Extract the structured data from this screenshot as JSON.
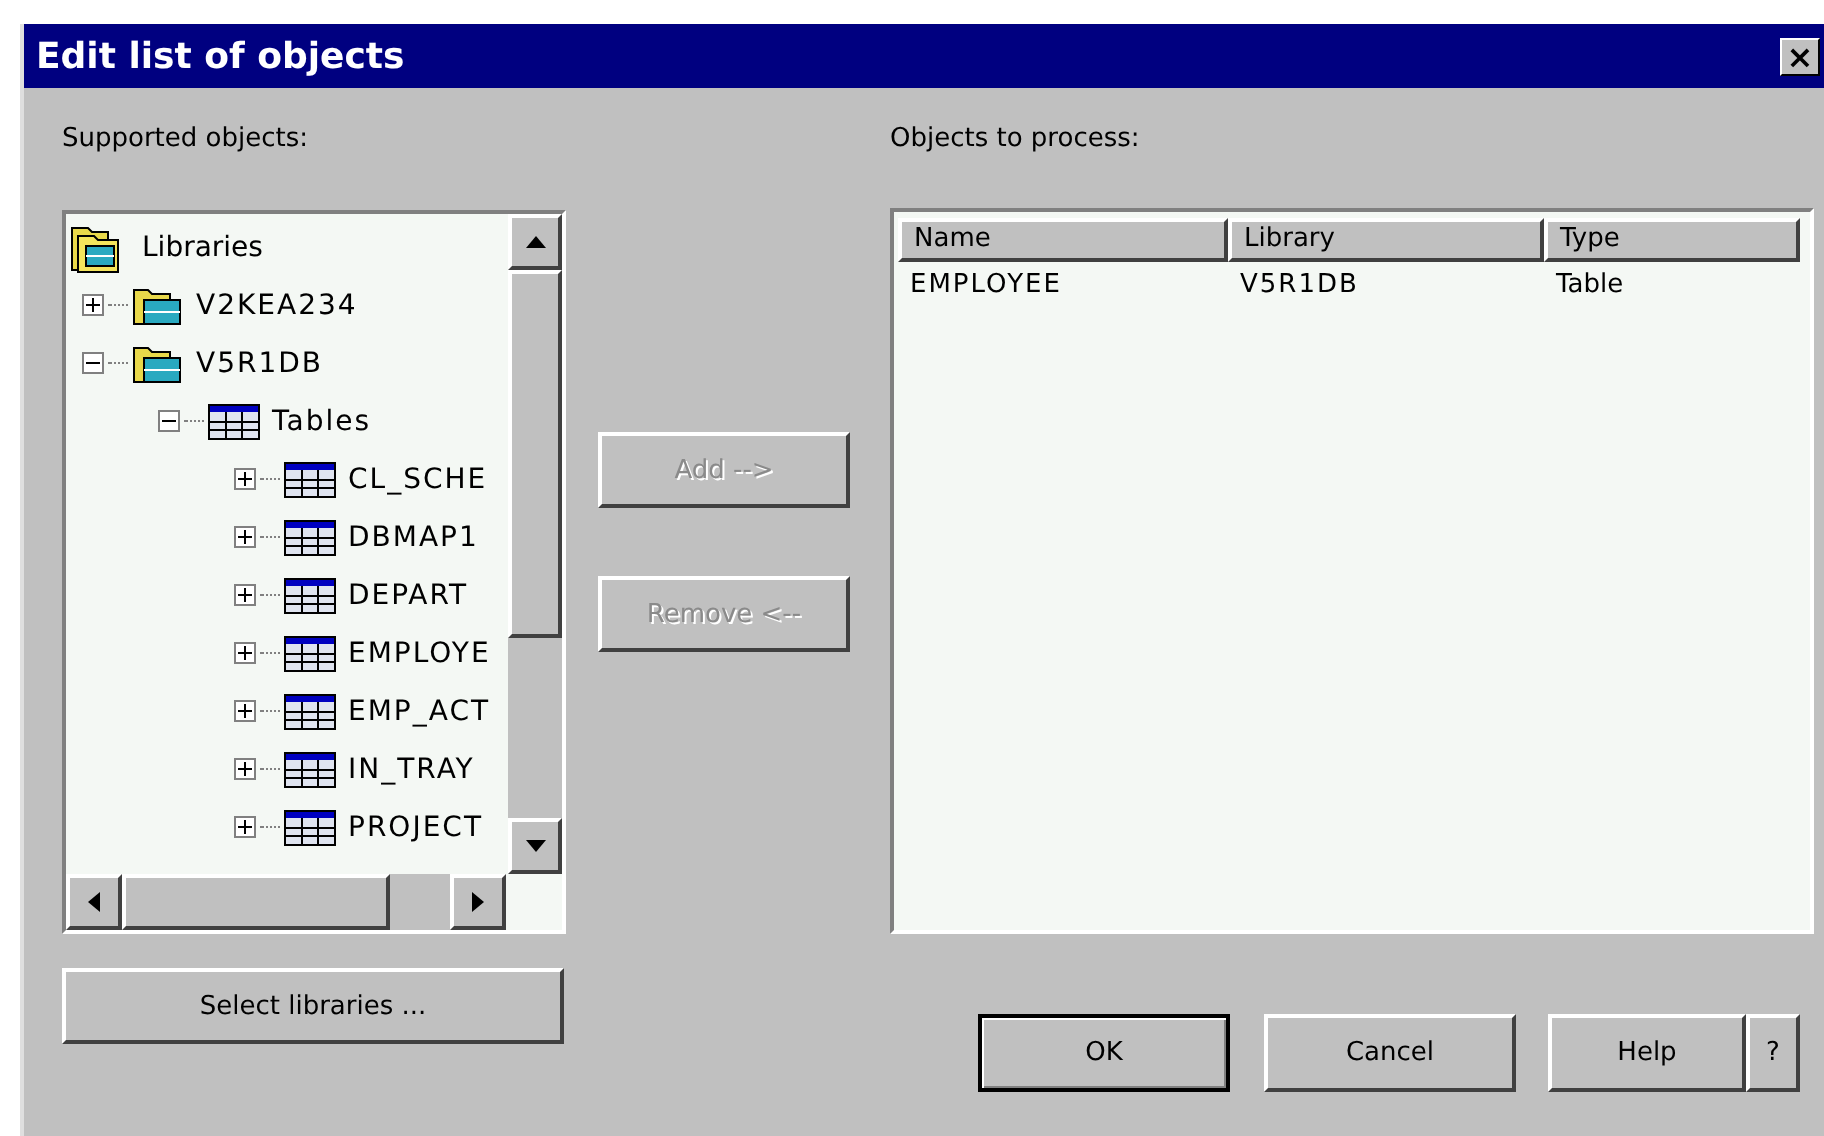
{
  "window": {
    "title": "Edit list of objects",
    "close": "×"
  },
  "supported_label": "Supported objects:",
  "process_label": "Objects to process:",
  "tree": {
    "label": "Libraries",
    "kind": "libraries",
    "children": [
      {
        "label": "V2KEA234",
        "kind": "library",
        "expanded": false
      },
      {
        "label": "V5R1DB",
        "kind": "library",
        "expanded": true,
        "children": [
          {
            "label": "Tables",
            "kind": "table",
            "expanded": true,
            "children": [
              {
                "label": "CL_SCHE",
                "kind": "table",
                "expanded": false
              },
              {
                "label": "DBMAP1",
                "kind": "table",
                "expanded": false
              },
              {
                "label": "DEPART",
                "kind": "table",
                "expanded": false
              },
              {
                "label": "EMPLOYE",
                "kind": "table",
                "expanded": false
              },
              {
                "label": "EMP_ACT",
                "kind": "table",
                "expanded": false
              },
              {
                "label": "IN_TRAY",
                "kind": "table",
                "expanded": false
              },
              {
                "label": "PROJECT",
                "kind": "table",
                "expanded": false
              }
            ]
          }
        ]
      }
    ]
  },
  "move_buttons": [
    {
      "label": "Add -->",
      "disabled": true
    },
    {
      "label": "Remove <--",
      "disabled": true
    }
  ],
  "select_button": "Select libraries ...",
  "table": {
    "columns": [
      "Name",
      "Library",
      "Type"
    ],
    "rows": [
      [
        "EMPLOYEE",
        "V5R1DB",
        "Table"
      ]
    ]
  },
  "buttons": [
    {
      "label": "OK",
      "default": true
    },
    {
      "label": "Cancel",
      "default": false
    },
    {
      "label": "Help",
      "default": false
    },
    {
      "label": "?",
      "default": false
    }
  ]
}
